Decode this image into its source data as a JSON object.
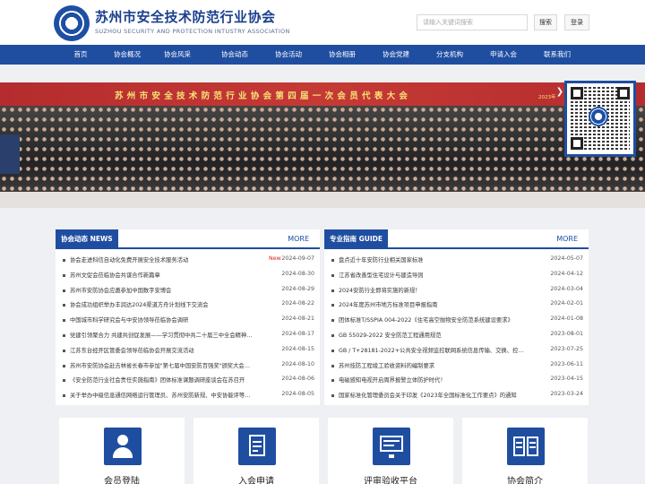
{
  "header": {
    "title": "苏州市安全技术防范行业协会",
    "subtitle": "SUZHOU SECURITY AND PROTECTION INTUSTRY ASSOCIATION",
    "search_placeholder": "请输入关键词搜索",
    "search_button": "搜索",
    "login_button": "登录"
  },
  "nav": [
    "首页",
    "协会概况",
    "协会风采",
    "协会动态",
    "协会活动",
    "协会相册",
    "协会党建",
    "分支机构",
    "申请入会",
    "联系我们"
  ],
  "banner": {
    "headline": "苏州市安全技术防范行业协会第四届一次会员代表大会",
    "year_fragment": "2023年"
  },
  "panels": {
    "news": {
      "tag": "协会动态 NEWS",
      "more": "MORE",
      "items": [
        {
          "title": "协会走进科信自动化免费开展安全技术服务活动",
          "badge": "New",
          "date": "2024-09-07"
        },
        {
          "title": "苏州文促会莅临协会共谋合作新篇章",
          "date": "2024-08-30"
        },
        {
          "title": "苏州市安防协会应邀参加中国数字安博会",
          "date": "2024-08-29"
        },
        {
          "title": "协会成功组织举办丰润达2024渠道方舟计划线下交流会",
          "date": "2024-08-22"
        },
        {
          "title": "中国城市科学研究会与中安协领导莅临协会调研",
          "date": "2024-08-21"
        },
        {
          "title": "党建引领聚合力 共建共创促发展——学习贯彻中共二十届三中全会精神…",
          "date": "2024-08-17"
        },
        {
          "title": "江苏东台经开区管委会领导莅临协会开展交流活动",
          "date": "2024-08-15"
        },
        {
          "title": "苏州市安防协会赴吉林省长春市参加\"第七届中国安防百强奖\"颁奖大会…",
          "date": "2024-08-10"
        },
        {
          "title": "《安全防范行业社会责任实施指南》团体标准课题调研座谈会在苏召开",
          "date": "2024-08-06"
        },
        {
          "title": "关于举办中级信息通信网络运行管理员、苏州安防新规、中安协能评等…",
          "date": "2024-08-05"
        }
      ]
    },
    "guide": {
      "tag": "专业指南 GUIDE",
      "more": "MORE",
      "items": [
        {
          "title": "盘点近十年安防行业相关国家标准",
          "date": "2024-05-07"
        },
        {
          "title": "江苏省改善型住宅设计与建造导则",
          "date": "2024-04-12"
        },
        {
          "title": "2024安防行业即将实施的新规！",
          "date": "2024-03-04"
        },
        {
          "title": "2024年度苏州市地方标准项目申报指南",
          "date": "2024-02-01"
        },
        {
          "title": "团体标准T/SSPIA 004-2022《住宅高空抛物安全防范系统建设要求》",
          "date": "2024-01-08"
        },
        {
          "title": "GB 55029-2022 安全防范工程通用规范",
          "date": "2023-08-01"
        },
        {
          "title": "GB / T+28181-2022+公共安全视频监控联网系统信息传输、交换、控…",
          "date": "2023-07-25"
        },
        {
          "title": "苏州技防工程竣工验收资料的编制要求",
          "date": "2023-06-11"
        },
        {
          "title": "电磁感知电视开启周界报警立体防护时代！",
          "date": "2023-04-15"
        },
        {
          "title": "国家标准化管理委员会关于印发《2023年全国标准化工作要点》的通知",
          "date": "2023-03-24"
        }
      ]
    }
  },
  "cards": [
    {
      "label": "会员登陆",
      "icon": "member-login-icon"
    },
    {
      "label": "入会申请",
      "icon": "application-form-icon"
    },
    {
      "label": "评审验收平台",
      "icon": "monitor-platform-icon"
    },
    {
      "label": "协会简介",
      "icon": "book-intro-icon"
    }
  ],
  "colors": {
    "primary": "#1f4ea1",
    "banner_red": "#b52c2e",
    "banner_text": "#f6e27a",
    "new_badge": "#e02020"
  }
}
